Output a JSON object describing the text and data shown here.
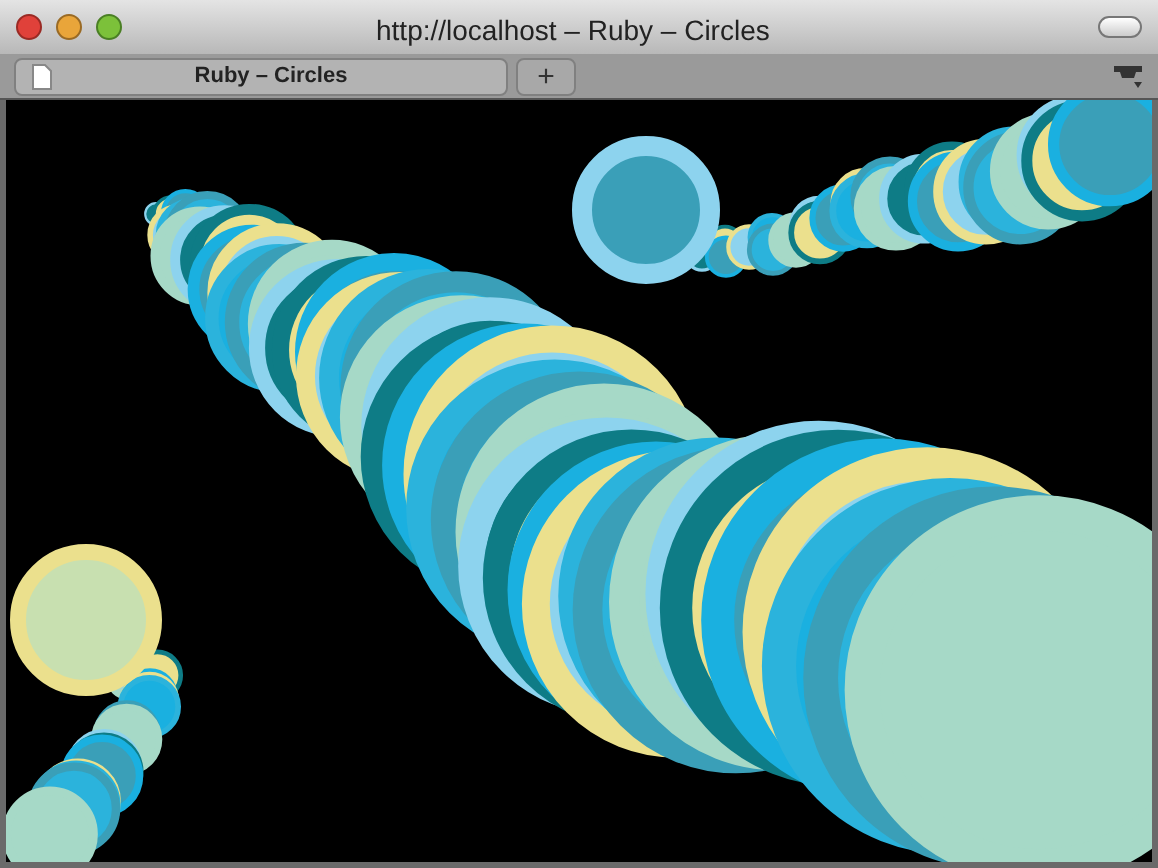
{
  "window": {
    "title": "http://localhost – Ruby – Circles"
  },
  "tabs": [
    {
      "label": "Ruby – Circles",
      "selected": true
    }
  ],
  "new_tab_button": {
    "label": "+"
  }
}
